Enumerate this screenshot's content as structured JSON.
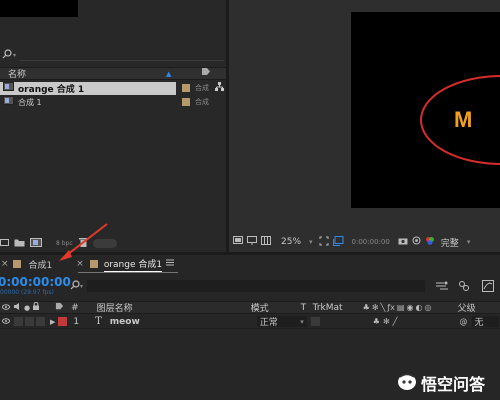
{
  "project": {
    "search_placeholder": "",
    "header": {
      "name_label": "名称"
    },
    "items": [
      {
        "name": "orange 合成 1",
        "type": "合成"
      },
      {
        "name": "合成 1",
        "type": "合成"
      }
    ],
    "bpc": "8 bpc"
  },
  "viewer": {
    "zoom": "25%",
    "timecode": "0:00:00:00",
    "quality": "完整",
    "overlay_text": "M"
  },
  "tabs": [
    {
      "label": "合成1"
    },
    {
      "label": "orange 合成1"
    }
  ],
  "timeline": {
    "timecode": "0:00:00:00",
    "fps": "00000 (29.97 fps)",
    "search_placeholder": "",
    "columns": {
      "hash": "#",
      "layer_name": "图层名称",
      "mode": "模式",
      "t": "T",
      "trkmat": "TrkMat",
      "parent": "父级"
    },
    "layers": [
      {
        "index": "1",
        "type_icon": "T",
        "name": "meow",
        "mode": "正常",
        "parent": "无"
      }
    ]
  },
  "watermark": {
    "text": "悟空问答"
  },
  "colors": {
    "accent_blue": "#2d8ceb",
    "label_tan": "#b59a6b",
    "label_red": "#c23a3a",
    "overlay_orange": "#f2a11a",
    "ellipse_red": "#d62c2c",
    "arrow_red": "#e03a2a"
  }
}
